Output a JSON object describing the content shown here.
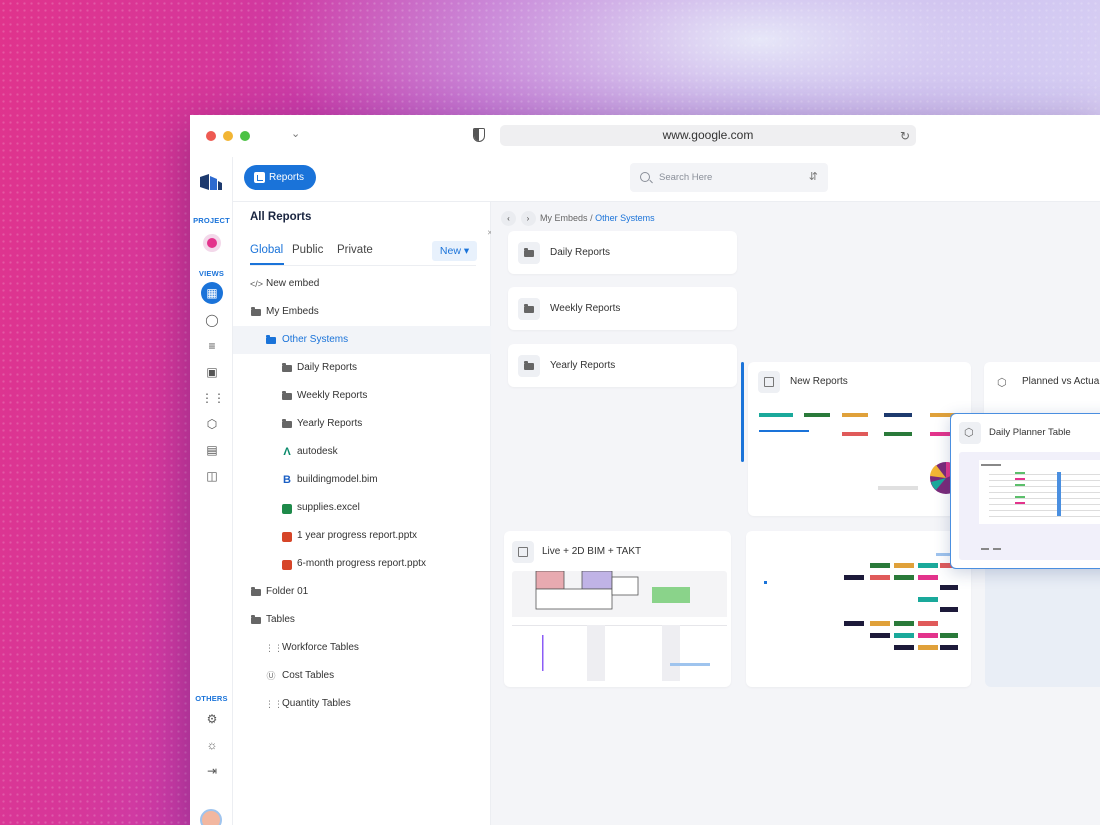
{
  "browser": {
    "url": "www.google.com"
  },
  "rail": {
    "project_label": "PROJECT",
    "views_label": "VIEWS",
    "others_label": "OTHERS",
    "view_icons": [
      "grid-icon",
      "dashboard-icon",
      "list-icon",
      "calendar-icon",
      "columns-icon",
      "cube-icon",
      "browser-icon",
      "layout-icon"
    ],
    "other_icons": [
      "gear-icon",
      "lightbulb-icon",
      "logout-icon"
    ]
  },
  "topbar": {
    "reports_label": "Reports",
    "search_placeholder": "Search Here"
  },
  "tree": {
    "title": "All Reports",
    "tabs": [
      "Global",
      "Public",
      "Private"
    ],
    "new_label": "New",
    "items": [
      {
        "label": "New embed",
        "icon": "code-icon",
        "level": 0
      },
      {
        "label": "My Embeds",
        "icon": "folder-icon",
        "level": 0
      },
      {
        "label": "Other Systems",
        "icon": "folder-icon",
        "level": 1,
        "selected": true
      },
      {
        "label": "Daily Reports",
        "icon": "folder-icon",
        "level": 2
      },
      {
        "label": "Weekly Reports",
        "icon": "folder-icon",
        "level": 2
      },
      {
        "label": "Yearly Reports",
        "icon": "folder-icon",
        "level": 2
      },
      {
        "label": "autodesk",
        "icon": "autodesk-icon",
        "level": 2
      },
      {
        "label": "buildingmodel.bim",
        "icon": "bim-icon",
        "level": 2
      },
      {
        "label": "supplies.excel",
        "icon": "excel-icon",
        "level": 2
      },
      {
        "label": "1 year progress report.pptx",
        "icon": "pptx-icon",
        "level": 2
      },
      {
        "label": "6-month progress report.pptx",
        "icon": "pptx-icon",
        "level": 2
      },
      {
        "label": "Folder 01",
        "icon": "folder-icon",
        "level": 0
      },
      {
        "label": "Tables",
        "icon": "folder-icon",
        "level": 0
      },
      {
        "label": "Workforce Tables",
        "icon": "columns-icon",
        "level": 1
      },
      {
        "label": "Cost Tables",
        "icon": "dollar-icon",
        "level": 1
      },
      {
        "label": "Quantity Tables",
        "icon": "columns-icon",
        "level": 1
      }
    ]
  },
  "breadcrumb": {
    "parent": "My Embeds",
    "separator": "/",
    "current": "Other Systems"
  },
  "cards": {
    "folders": [
      "Daily Reports",
      "Weekly Reports",
      "Yearly Reports"
    ],
    "new_reports": "New Reports",
    "planned": "Planned vs Actua",
    "live": "Live + 2D BIM + TAKT",
    "popup": "Daily Planner Table"
  },
  "colors": {
    "accent": "#1a73d9",
    "pink": "#e3338c",
    "panel": "#f4f5f8"
  }
}
